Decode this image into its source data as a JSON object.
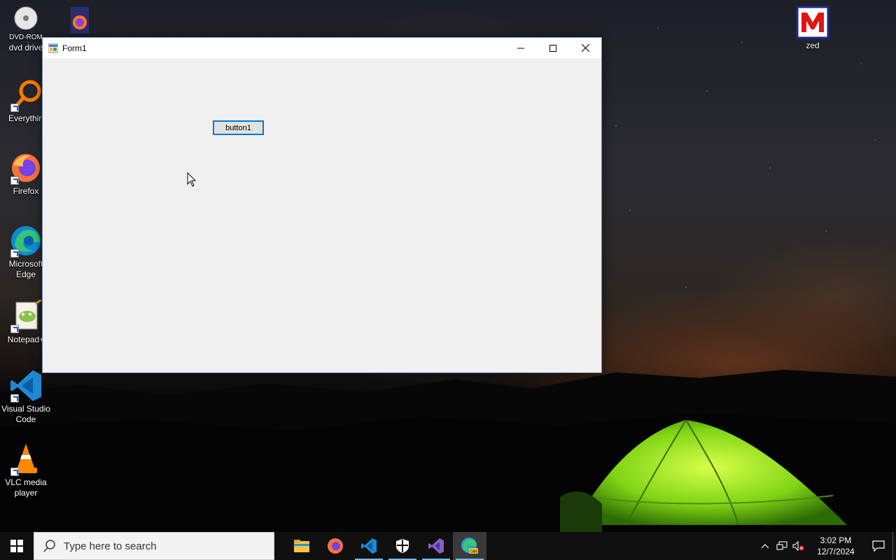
{
  "desktop": {
    "icons": [
      {
        "label": "dvd drive",
        "sublabel": "DVD-ROM",
        "icon": "dvd-drive-icon"
      },
      {
        "label": "",
        "icon": "firefox-file-icon"
      },
      {
        "label": "Everythin",
        "icon": "everything-search-icon"
      },
      {
        "label": "Firefox",
        "icon": "firefox-icon"
      },
      {
        "label": "Microsoft Edge",
        "icon": "edge-icon"
      },
      {
        "label": "Notepad+",
        "icon": "notepad-plus-plus-icon"
      },
      {
        "label": "Visual Studio Code",
        "icon": "vscode-icon"
      },
      {
        "label": "VLC media player",
        "icon": "vlc-icon"
      },
      {
        "label": "zed",
        "icon": "zed-icon"
      }
    ]
  },
  "window": {
    "title": "Form1",
    "button_label": "button1"
  },
  "taskbar": {
    "search_placeholder": "Type here to search",
    "apps": [
      {
        "name": "File Explorer",
        "icon": "file-explorer-icon"
      },
      {
        "name": "Firefox",
        "icon": "firefox-icon"
      },
      {
        "name": "Visual Studio Code",
        "icon": "vscode-icon"
      },
      {
        "name": "Windows Security",
        "icon": "shield-icon"
      },
      {
        "name": "Visual Studio",
        "icon": "visual-studio-icon"
      },
      {
        "name": "Microsoft Edge Canary",
        "icon": "edge-canary-icon"
      }
    ],
    "clock": {
      "time": "3:02 PM",
      "date": "12/7/2024"
    }
  },
  "colors": {
    "accent": "#0078d7",
    "taskbar": "#101010",
    "window_bg": "#f0f0f0"
  }
}
